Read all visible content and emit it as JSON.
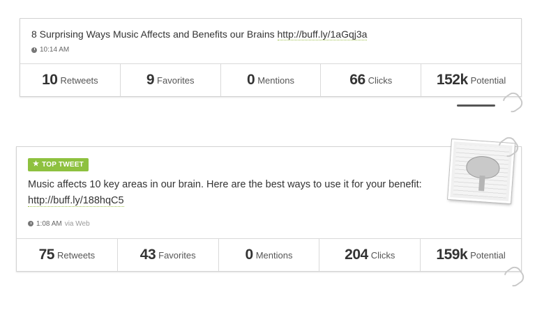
{
  "tweets": [
    {
      "text": "8 Surprising Ways Music Affects and Benefits our Brains ",
      "link": "http://buff.ly/1aGqj3a",
      "time": "10:14 AM",
      "via": "",
      "badge": "",
      "stats": [
        {
          "value": "10",
          "label": "Retweets"
        },
        {
          "value": "9",
          "label": "Favorites"
        },
        {
          "value": "0",
          "label": "Mentions"
        },
        {
          "value": "66",
          "label": "Clicks"
        },
        {
          "value": "152k",
          "label": "Potential"
        }
      ]
    },
    {
      "text": "Music affects 10 key areas in our brain. Here are the best ways to use it for your benefit: ",
      "link": "http://buff.ly/188hqC5",
      "time": "1:08 AM",
      "via": "via Web",
      "badge": "TOP TWEET",
      "badge_icon": "★",
      "stats": [
        {
          "value": "75",
          "label": "Retweets"
        },
        {
          "value": "43",
          "label": "Favorites"
        },
        {
          "value": "0",
          "label": "Mentions"
        },
        {
          "value": "204",
          "label": "Clicks"
        },
        {
          "value": "159k",
          "label": "Potential"
        }
      ]
    }
  ],
  "colors": {
    "badge": "#8ec13f",
    "text": "#333333",
    "border": "#d3d3d3"
  }
}
